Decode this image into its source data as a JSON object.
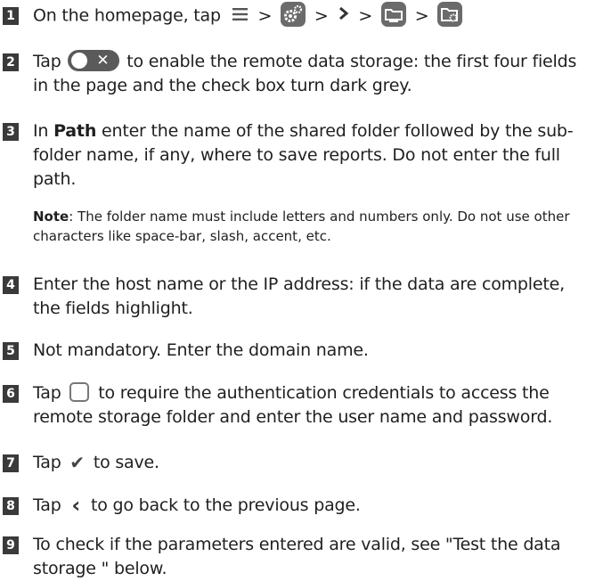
{
  "steps": [
    {
      "num": "1",
      "text": "On the homepage, tap",
      "separator": ">"
    },
    {
      "num": "2",
      "before": "Tap",
      "after": "to enable the remote data storage: the first four fields in the page and the check box turn dark grey.",
      "toggle_x": "✕"
    },
    {
      "num": "3",
      "before": "In",
      "bold": "Path",
      "after": "enter the name of the shared folder followed by the sub-folder name, if any, where to save reports. Do not enter the full path."
    },
    {
      "num": "4",
      "text": "Enter the host name or the IP address: if the data are complete, the fields highlight."
    },
    {
      "num": "5",
      "text": "Not mandatory. Enter the domain name."
    },
    {
      "num": "6",
      "before": "Tap",
      "after": "to require the authentication credentials to access the remote storage folder and enter the user name and password."
    },
    {
      "num": "7",
      "before": "Tap",
      "after": "to save.",
      "check_glyph": "✔"
    },
    {
      "num": "8",
      "before": "Tap",
      "after": "to go back to the previous page.",
      "back_glyph": "‹"
    },
    {
      "num": "9",
      "text": "To check if the parameters entered are valid, see \"Test the data storage \" below."
    }
  ],
  "note": {
    "label": "Note",
    "text": ": The folder name must include letters and numbers only. Do not use other characters like space-bar, slash, accent, etc."
  },
  "icons": [
    "menu-icon",
    "settings-icon",
    "chevron-right-icon",
    "folder-icon",
    "folder-settings-icon",
    "toggle-icon",
    "checkbox-icon",
    "check-icon",
    "back-icon"
  ],
  "colors": {
    "badge": "#3a3a3a",
    "icon": "#6b6b6b"
  }
}
